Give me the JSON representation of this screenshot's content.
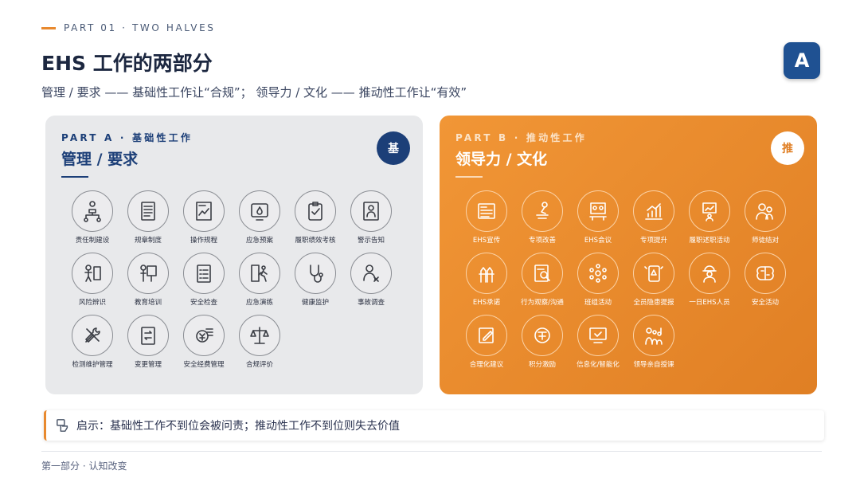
{
  "header": {
    "kicker": "PART 01 · TWO HALVES",
    "title": "EHS 工作的两部分",
    "subtitle": "管理 / 要求 —— 基础性工作让“合规”； 领导力 / 文化 —— 推动性工作让“有效”",
    "badge": "A"
  },
  "panel_a": {
    "tag": "PART A · 基础性工作",
    "title": "管理 / 要求",
    "badge": "基",
    "items": [
      {
        "label": "责任制建设",
        "icon": "org-chart-icon"
      },
      {
        "label": "规章制度",
        "icon": "document-list-icon"
      },
      {
        "label": "操作规程",
        "icon": "procedure-doc-icon"
      },
      {
        "label": "应急预案",
        "icon": "fire-alert-icon"
      },
      {
        "label": "履职绩效考核",
        "icon": "clipboard-check-icon"
      },
      {
        "label": "警示告知",
        "icon": "warning-board-icon"
      },
      {
        "label": "风险辨识",
        "icon": "risk-identify-icon"
      },
      {
        "label": "教育培训",
        "icon": "training-icon"
      },
      {
        "label": "安全检查",
        "icon": "checklist-icon"
      },
      {
        "label": "应急演练",
        "icon": "emergency-exit-icon"
      },
      {
        "label": "健康监护",
        "icon": "stethoscope-icon"
      },
      {
        "label": "事故调查",
        "icon": "investigation-icon"
      },
      {
        "label": "检测维护管理",
        "icon": "tools-icon"
      },
      {
        "label": "变更管理",
        "icon": "change-doc-icon"
      },
      {
        "label": "安全经费管理",
        "icon": "funding-icon"
      },
      {
        "label": "合规评价",
        "icon": "scale-icon"
      }
    ]
  },
  "panel_b": {
    "tag": "PART B · 推动性工作",
    "title": "领导力 / 文化",
    "badge": "推",
    "items": [
      {
        "label": "EHS宣传",
        "icon": "news-icon"
      },
      {
        "label": "专项改善",
        "icon": "improve-icon"
      },
      {
        "label": "EHS会议",
        "icon": "meeting-icon"
      },
      {
        "label": "专项提升",
        "icon": "growth-chart-icon"
      },
      {
        "label": "履职述职活动",
        "icon": "report-icon"
      },
      {
        "label": "师徒结对",
        "icon": "mentor-icon"
      },
      {
        "label": "EHS承诺",
        "icon": "commitment-icon"
      },
      {
        "label": "行为观察/沟通",
        "icon": "observation-icon"
      },
      {
        "label": "班组活动",
        "icon": "team-icon"
      },
      {
        "label": "全员隐患提报",
        "icon": "hazard-report-icon"
      },
      {
        "label": "一日EHS人员",
        "icon": "safety-worker-icon"
      },
      {
        "label": "安全活动",
        "icon": "brain-icon"
      },
      {
        "label": "合理化建议",
        "icon": "suggestion-icon"
      },
      {
        "label": "积分激励",
        "icon": "points-icon"
      },
      {
        "label": "信息化/智能化",
        "icon": "digital-icon"
      },
      {
        "label": "领导亲自授课",
        "icon": "leader-lecture-icon"
      }
    ]
  },
  "note": {
    "text": "启示：基础性工作不到位会被问责；推动性工作不到位则失去价值"
  },
  "footer": {
    "text": "第一部分 · 认知改变"
  },
  "colors": {
    "navy": "#1c3f78",
    "orange": "#e8892e",
    "panel_grey": "#e8e9eb"
  }
}
